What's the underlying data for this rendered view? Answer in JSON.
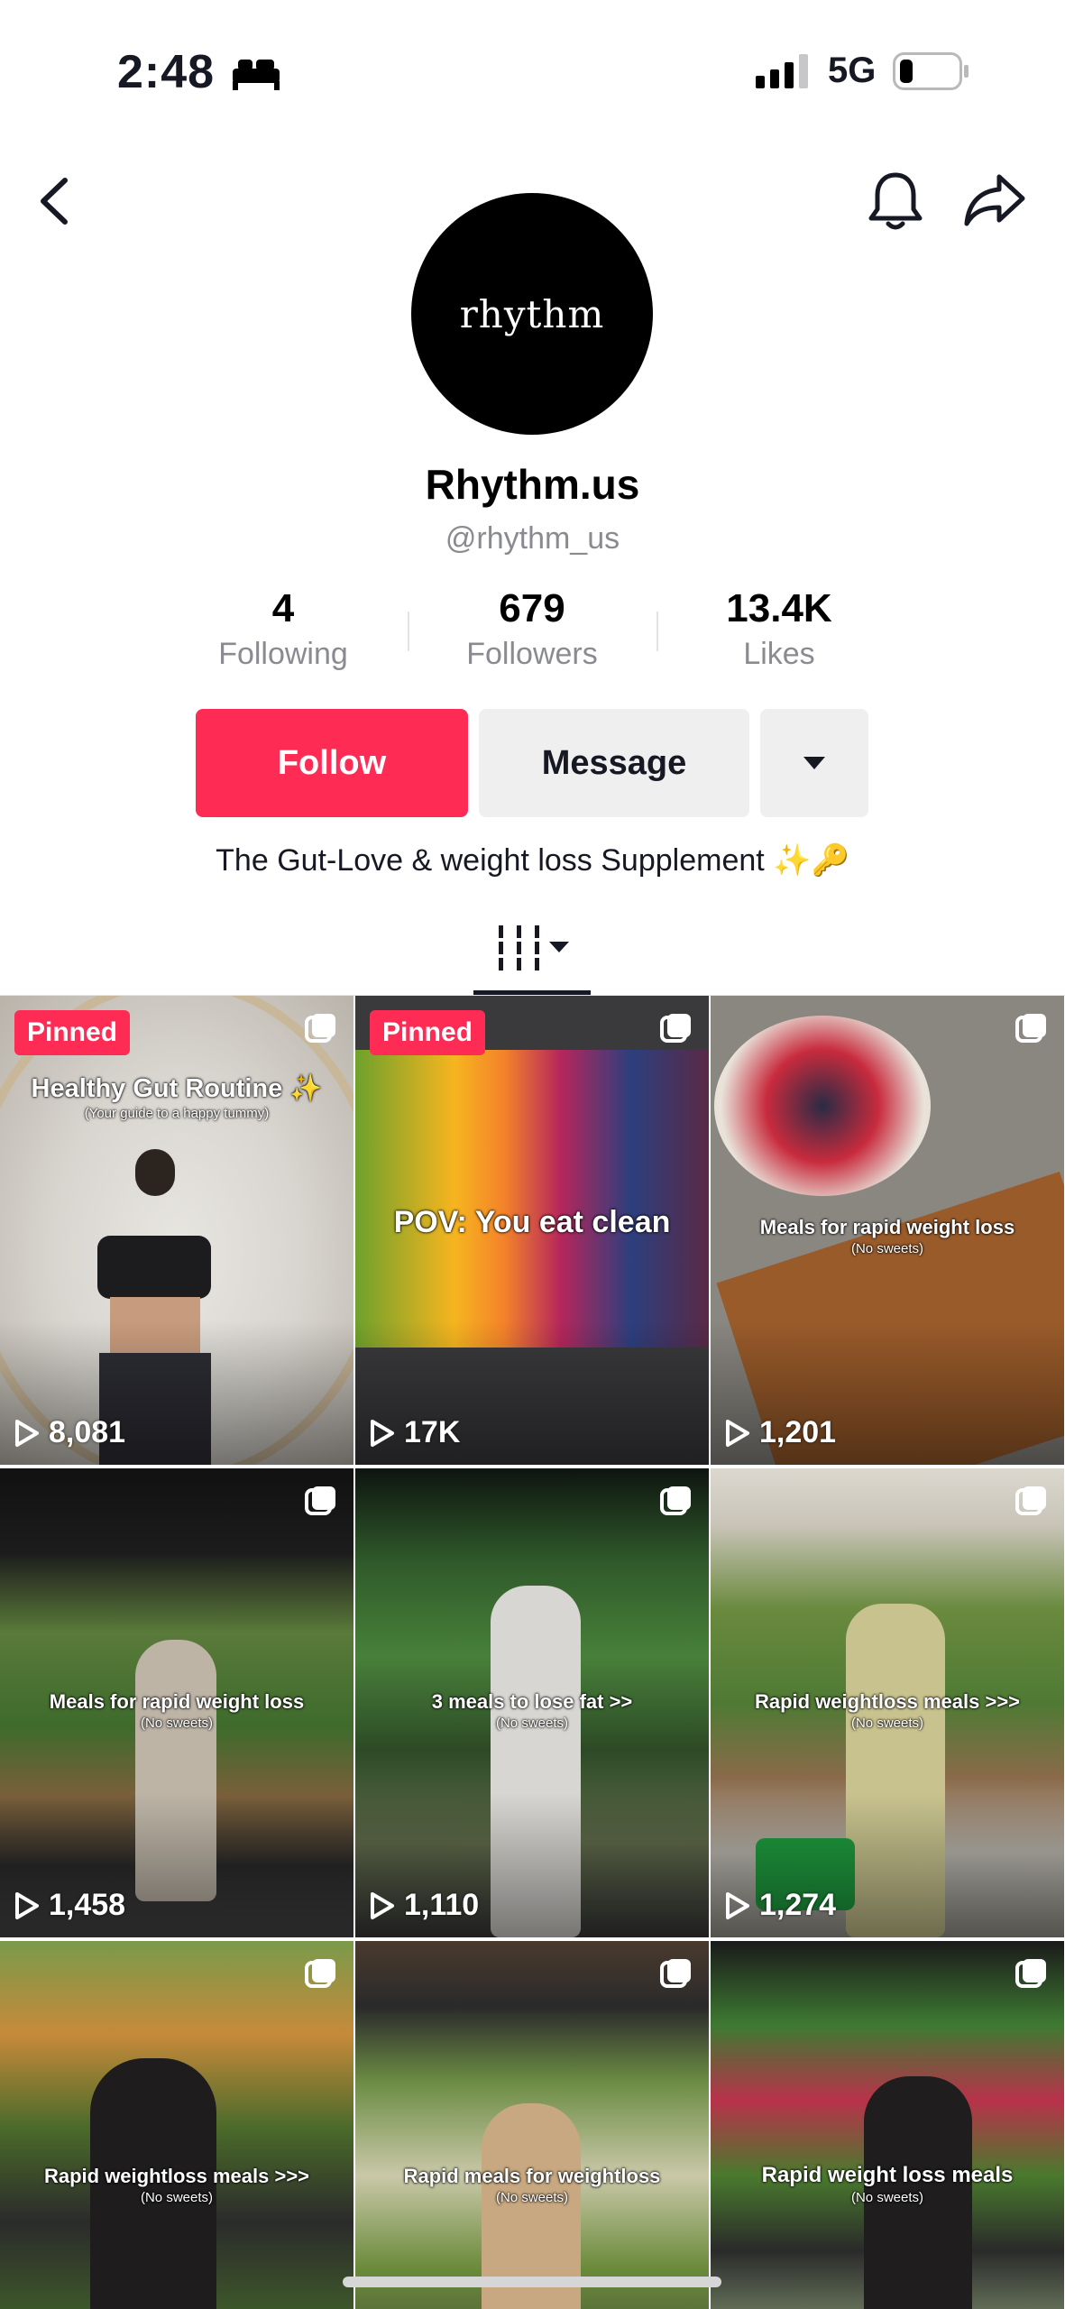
{
  "status_bar": {
    "time": "2:48",
    "network": "5G",
    "sleep_icon": "bed-icon",
    "signal_icon": "cellular-signal-icon",
    "battery_icon": "battery-icon"
  },
  "nav": {
    "back_icon": "chevron-left-icon",
    "bell_icon": "bell-icon",
    "share_icon": "share-arrow-icon"
  },
  "profile": {
    "avatar_text": "rhythm",
    "display_name": "Rhythm.us",
    "handle": "@rhythm_us",
    "bio": "The Gut-Love & weight loss Supplement ✨🔑"
  },
  "stats": [
    {
      "value": "4",
      "label": "Following"
    },
    {
      "value": "679",
      "label": "Followers"
    },
    {
      "value": "13.4K",
      "label": "Likes"
    }
  ],
  "actions": {
    "follow": "Follow",
    "message": "Message",
    "more_icon": "caret-down-icon"
  },
  "tabs": {
    "videos_icon": "grid-bars-icon"
  },
  "colors": {
    "accent": "#fe2c55",
    "secondary_button": "#efefef",
    "muted_text": "#8a8b91"
  },
  "videos": [
    {
      "pinned": "Pinned",
      "caption": "Healthy Gut Routine ✨",
      "subcaption": "(Your guide to a happy tummy)",
      "views": "8,081"
    },
    {
      "pinned": "Pinned",
      "caption": "POV: You eat clean",
      "subcaption": "",
      "views": "17K"
    },
    {
      "pinned": "",
      "caption": "Meals for rapid weight loss",
      "subcaption": "(No sweets)",
      "views": "1,201"
    },
    {
      "pinned": "",
      "caption": "Meals for rapid weight loss",
      "subcaption": "(No sweets)",
      "views": "1,458"
    },
    {
      "pinned": "",
      "caption": "3 meals to lose fat >>",
      "subcaption": "(No sweets)",
      "views": "1,110"
    },
    {
      "pinned": "",
      "caption": "Rapid weightloss meals >>>",
      "subcaption": "(No sweets)",
      "views": "1,274"
    },
    {
      "pinned": "",
      "caption": "Rapid weightloss meals >>>",
      "subcaption": "(No sweets)",
      "views": ""
    },
    {
      "pinned": "",
      "caption": "Rapid meals for weightloss",
      "subcaption": "(No sweets)",
      "views": ""
    },
    {
      "pinned": "",
      "caption": "Rapid weight loss meals",
      "subcaption": "(No sweets)",
      "views": ""
    }
  ]
}
